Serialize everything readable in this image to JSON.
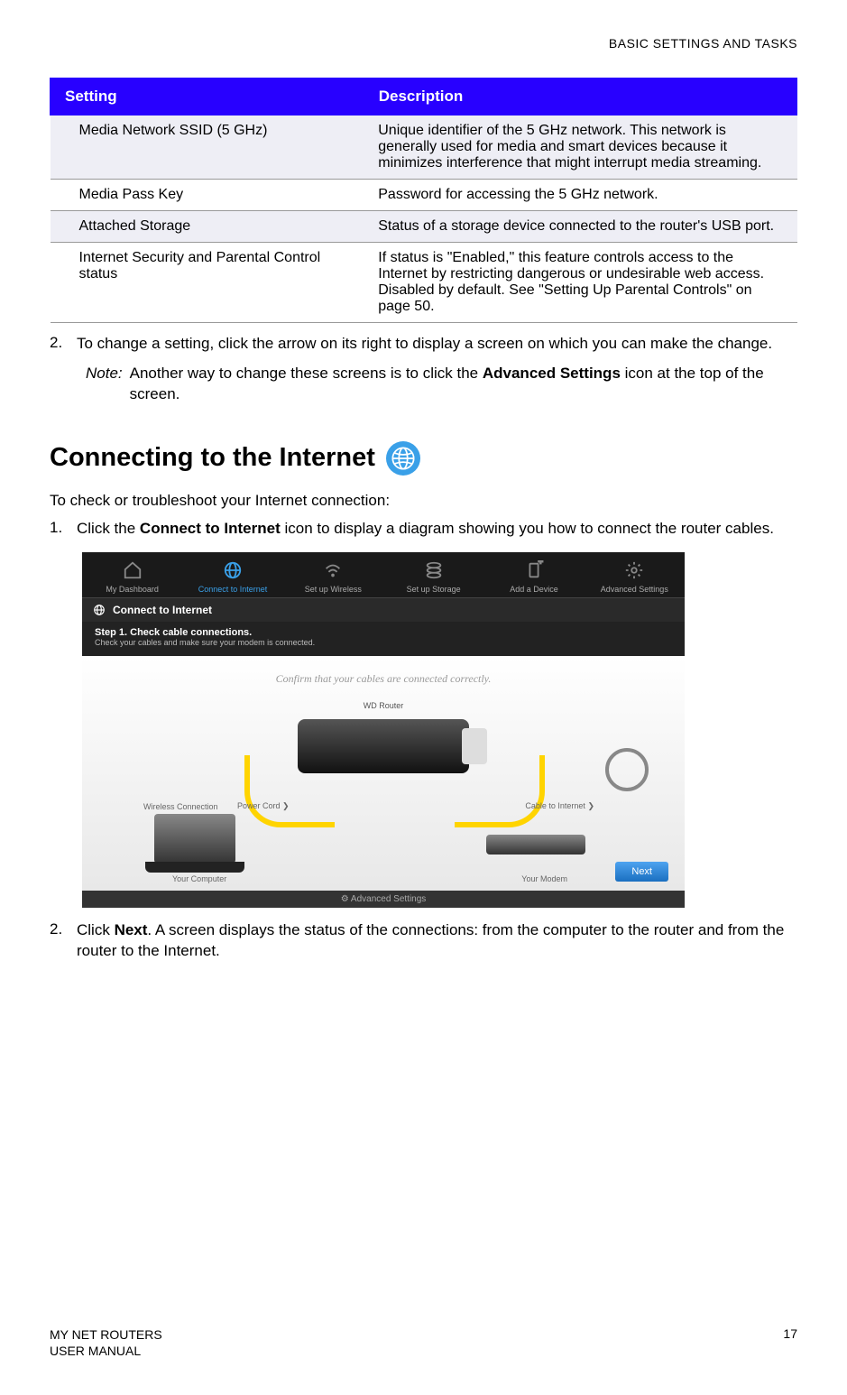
{
  "header": {
    "section": "BASIC SETTINGS AND TASKS"
  },
  "table": {
    "col1": "Setting",
    "col2": "Description",
    "rows": [
      {
        "setting": "Media Network SSID (5 GHz)",
        "desc": "Unique identifier of the 5 GHz network. This network is generally used for media and smart devices because it minimizes interference that might interrupt media streaming."
      },
      {
        "setting": "Media Pass Key",
        "desc": "Password for accessing the 5 GHz network."
      },
      {
        "setting": "Attached Storage",
        "desc": "Status of a storage device connected to the router's USB port."
      },
      {
        "setting": "Internet Security and Parental Control status",
        "desc": "If status is \"Enabled,\" this feature controls access to the Internet by restricting dangerous or undesirable web access. Disabled by default. See \"Setting Up Parental Controls\" on page 50."
      }
    ]
  },
  "step2a": {
    "num": "2.",
    "text": "To change a setting, click the arrow on its right to display a screen on which you can make the change."
  },
  "note": {
    "label": "Note:",
    "before": "Another way to change these screens is to click the ",
    "bold": "Advanced Settings",
    "after": " icon at the top of the screen."
  },
  "section_title": "Connecting to the Internet",
  "lead": "To check or troubleshoot your Internet connection:",
  "step1": {
    "num": "1.",
    "before": "Click the ",
    "bold": "Connect to Internet",
    "after": " icon to display a diagram showing you how to connect the router cables."
  },
  "screenshot": {
    "nav": {
      "dashboard": "My Dashboard",
      "connect": "Connect to Internet",
      "wireless": "Set up Wireless",
      "storage": "Set up Storage",
      "device": "Add a Device",
      "advanced": "Advanced Settings"
    },
    "bar": "Connect to Internet",
    "sub_title": "Step 1. Check cable connections.",
    "sub_text": "Check your cables and make sure your modem is connected.",
    "confirm": "Confirm that your cables are connected correctly.",
    "router": "WD Router",
    "wireless_conn": "Wireless Connection",
    "power_cord": "Power Cord",
    "cable_internet": "Cable to Internet",
    "your_computer": "Your Computer",
    "your_modem": "Your Modem",
    "next": "Next",
    "footer": "Advanced Settings",
    "chev": "❯"
  },
  "step2b": {
    "num": "2.",
    "before": "Click ",
    "bold": "Next",
    "after": ". A screen displays the status of the connections: from the computer to the router and from the router to the Internet."
  },
  "footer": {
    "line1": "MY NET ROUTERS",
    "line2": "USER MANUAL",
    "page": "17"
  }
}
